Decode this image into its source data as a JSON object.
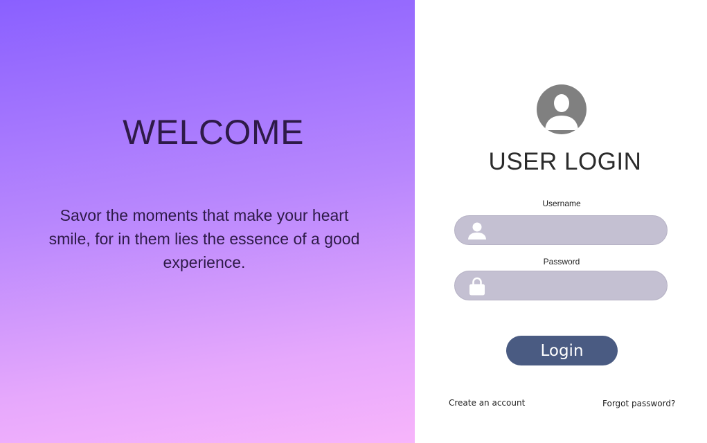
{
  "welcome": {
    "title": "WELCOME",
    "quote": "Savor the moments that make your heart smile, for in them lies the essence of a good experience."
  },
  "login": {
    "avatar_icon": "user-avatar-icon",
    "title": "USER LOGIN",
    "username": {
      "label": "Username",
      "value": "",
      "icon": "user-icon"
    },
    "password": {
      "label": "Password",
      "value": "",
      "icon": "lock-icon"
    },
    "button_label": "Login",
    "create_account": "Create an account",
    "forgot_password": "Forgot password?"
  },
  "colors": {
    "gradient_top": "#8a60ff",
    "gradient_bottom": "#f7b5fb",
    "field_bg": "#c4c0d2",
    "button_bg": "#4a5b82",
    "avatar_bg": "#808080"
  }
}
